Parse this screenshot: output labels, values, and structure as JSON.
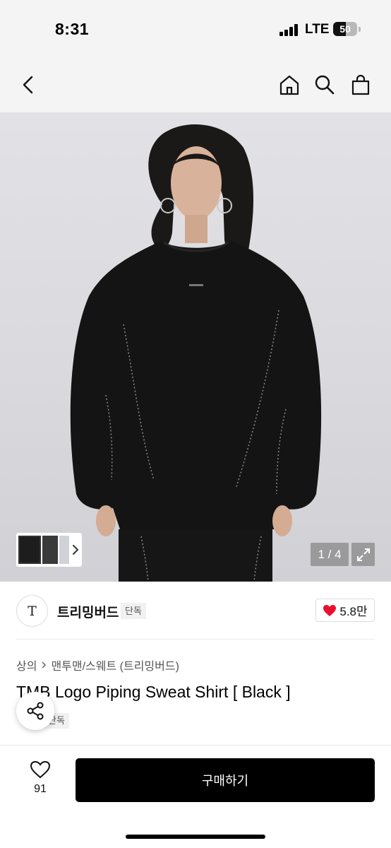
{
  "status_bar": {
    "time": "8:31",
    "network": "LTE",
    "battery": "50",
    "icons": [
      "signal-icon",
      "battery-icon"
    ]
  },
  "nav": {
    "icons": [
      "back-chevron-icon",
      "home-icon",
      "search-icon",
      "shopping-bag-icon"
    ]
  },
  "gallery": {
    "counter": "1 / 4",
    "icons": [
      "chevron-right-icon",
      "expand-icon"
    ]
  },
  "brand": {
    "logo_text": "T",
    "name": "트리밍버드",
    "badge": "단독",
    "likes": "5.8만",
    "colors": {
      "heart": "#e8112d"
    }
  },
  "product": {
    "breadcrumb": [
      "상의",
      "맨투맨/스웨트 (트리밍버드)"
    ],
    "title": "TMB Logo Piping Sweat Shirt [ Black ]",
    "badge": "단독",
    "icons": [
      "share-icon"
    ]
  },
  "bottom_bar": {
    "wish_count": "91",
    "buy_label": "구매하기",
    "icons": [
      "heart-outline-icon"
    ]
  }
}
